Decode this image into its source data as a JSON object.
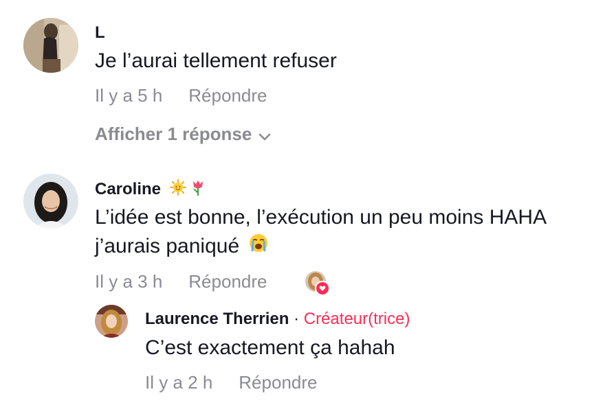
{
  "comments": [
    {
      "username": "L",
      "text": "Je l’aurai tellement refuser",
      "time": "Il y a 5 h",
      "reply_label": "Répondre",
      "show_replies": "Afficher 1 réponse"
    },
    {
      "username": "Caroline",
      "username_emojis": [
        "sun-with-face-emoji",
        "tulip-emoji"
      ],
      "text_line1": "L’idée est bonne, l’exécution un peu moins HAHA",
      "text_line2": "j’aurais paniqué",
      "text_emoji": "loudly-crying-face-emoji",
      "time": "Il y a 3 h",
      "reply_label": "Répondre",
      "liked_by_creator": true,
      "replies": [
        {
          "username": "Laurence Therrien",
          "separator": "·",
          "creator_label": "Créateur(trice)",
          "text": "C’est exactement ça hahah",
          "time": "Il y a 2 h",
          "reply_label": "Répondre"
        }
      ]
    }
  ],
  "colors": {
    "primary_text": "#161823",
    "secondary_text": "#8a8b91",
    "creator_accent": "#fe2c55",
    "background": "#ffffff"
  }
}
